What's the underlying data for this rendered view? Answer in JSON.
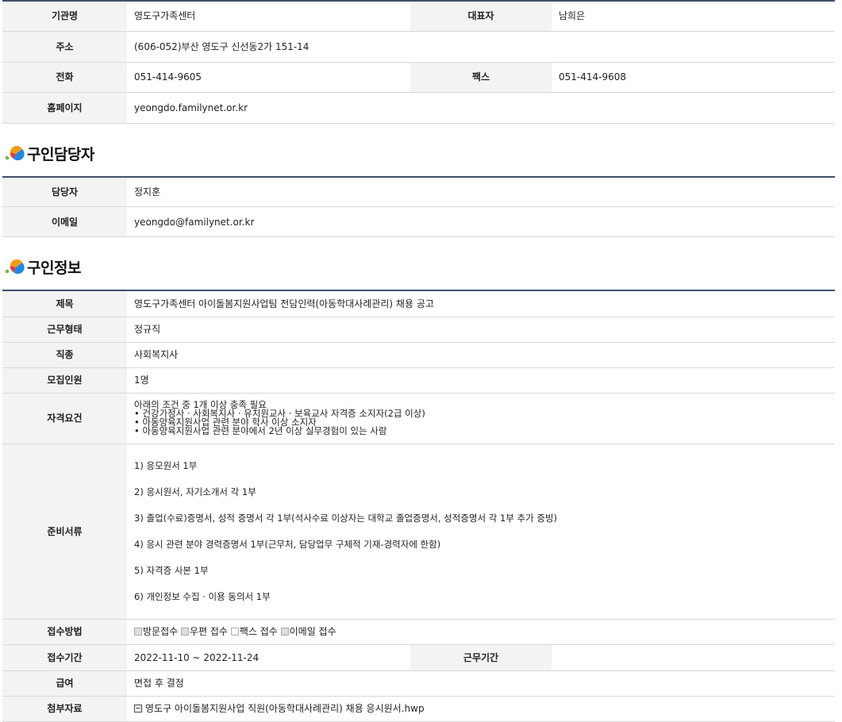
{
  "org": {
    "name_label": "기관명",
    "name": "영도구가족센터",
    "rep_label": "대표자",
    "rep": "남희은",
    "addr_label": "주소",
    "addr": "(606-052)부산 영도구 신선동2가 151-14",
    "phone_label": "전화",
    "phone": "051-414-9605",
    "fax_label": "팩스",
    "fax": "051-414-9608",
    "home_label": "홈페이지",
    "home": "yeongdo.familynet.or.kr"
  },
  "contact": {
    "title": "구인담당자",
    "person_label": "담당자",
    "person": "정지훈",
    "email_label": "이메일",
    "email": "yeongdo@familynet.or.kr"
  },
  "job": {
    "title": "구인정보",
    "subject_label": "제목",
    "subject": "영도구가족센터 아이돌봄지원사업팀 전담인력(아동학대사례관리) 채용 공고",
    "type_label": "근무형태",
    "type": "정규직",
    "category_label": "직종",
    "category": "사회복지사",
    "count_label": "모집인원",
    "count": "1명",
    "qual_label": "자격요건",
    "qual_lines": [
      "아래의 조건 중 1개 이상 충족 필요",
      " • 건강가정사 · 사회복지사 · 유치원교사 · 보육교사 자격증 소지자(2급 이상)",
      " • 아동양육지원사업 관련 분야 학사 이상 소지자",
      " • 아동양육지원사업 관련 분야에서 2년 이상 실무경험이 있는 사람"
    ],
    "docs_label": "준비서류",
    "docs_lines": [
      "  1) 응모원서 1부",
      "  2) 응시원서, 자기소개서 각 1부",
      "  3) 졸업(수료)증명서, 성적 증명서 각 1부(석사수료 이상자는 대학교 졸업증명서, 성적증명서 각 1부 추가 증빙)",
      "  4) 응시 관련 분야 경력증명서 1부(근무처, 담당업무 구체적 기재-경력자에 한함)",
      "  5) 자격증 사본 1부",
      "  6) 개인정보 수집 · 이용 동의서 1부"
    ],
    "method_label": "접수방법",
    "methods": [
      {
        "label": "방문접수",
        "checked": true
      },
      {
        "label": "우편 접수",
        "checked": true
      },
      {
        "label": "팩스 접수",
        "checked": false
      },
      {
        "label": "이메일 접수",
        "checked": true
      }
    ],
    "period_label": "접수기간",
    "period": "2022-11-10 ~ 2022-11-24",
    "work_period_label": "근무기간",
    "work_period": "",
    "salary_label": "급여",
    "salary": "면접 후 결정",
    "attach_label": "첨부자료",
    "attach": "영도구 아이돌봄지원사업 직원(아동학대사례관리) 채용 응시원서.hwp"
  }
}
